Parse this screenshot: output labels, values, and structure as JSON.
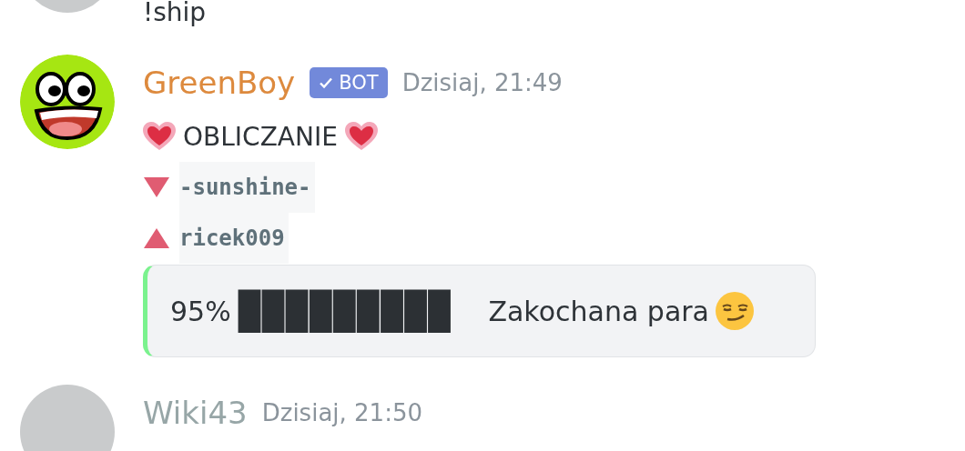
{
  "messages": [
    {
      "kind": "tail",
      "text": "!ship"
    },
    {
      "kind": "bot",
      "author": "GreenBoy",
      "color": "#dd8a3e",
      "bot_tag": "BOT",
      "time": "Dzisiaj, 21:49",
      "title": "OBLICZANIE",
      "users": [
        {
          "kind": "down",
          "name": "-sunshine-"
        },
        {
          "kind": "up",
          "name": "ricek009"
        }
      ],
      "embed": {
        "percent": "95%",
        "bar": "█████████",
        "verdict": "Zakochana para"
      }
    },
    {
      "kind": "user",
      "author": "Wiki43",
      "color": "#97a6a7",
      "time": "Dzisiaj, 21:50"
    }
  ]
}
